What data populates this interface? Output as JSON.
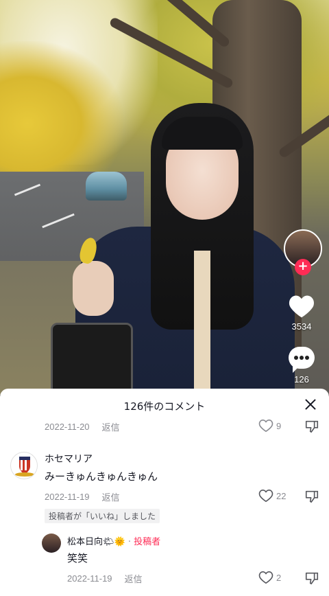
{
  "video": {
    "like_count": "3534",
    "comment_count": "126",
    "colors": {
      "accent": "#fe2c55"
    }
  },
  "comments_sheet": {
    "title": "126件のコメント",
    "partial_row": {
      "date": "2022-11-20",
      "reply_label": "返信",
      "like_count": "9"
    },
    "comments": [
      {
        "author": "ホセマリア",
        "text": "みーきゅんきゅんきゅん",
        "date": "2022-11-19",
        "reply_label": "返信",
        "like_count": "22",
        "liked_by_creator": "投稿者が「いいね」しました"
      }
    ],
    "reply": {
      "author": "松本日向",
      "author_suffix": "🌤🌞",
      "separator": "·",
      "creator_tag": "投稿者",
      "text": "笑笑",
      "date": "2022-11-19",
      "reply_label": "返信",
      "like_count": "2"
    }
  }
}
